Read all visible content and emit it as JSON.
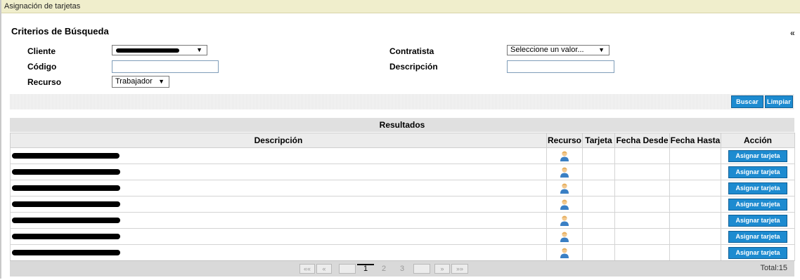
{
  "window_title": "Asignación de tarjetas",
  "criteria": {
    "title": "Criterios de Búsqueda",
    "collapse_glyph": "«",
    "cliente_label": "Cliente",
    "cliente_value": "",
    "contratista_label": "Contratista",
    "contratista_value": "Seleccione un valor...",
    "codigo_label": "Código",
    "codigo_value": "",
    "descripcion_label": "Descripción",
    "descripcion_value": "",
    "recurso_label": "Recurso",
    "recurso_value": "Trabajador"
  },
  "buttons": {
    "search": "Buscar",
    "clear": "Limpiar"
  },
  "results": {
    "title": "Resultados",
    "columns": [
      "Descripción",
      "Recurso",
      "Tarjeta",
      "Fecha Desde",
      "Fecha Hasta",
      "Acción"
    ],
    "action_label": "Asignar tarjeta",
    "row_count": 7
  },
  "pager": {
    "first": "««",
    "prev": "«",
    "pages": [
      "1",
      "2",
      "3"
    ],
    "current_page": "1",
    "next": "»",
    "last": "»»",
    "total_text": "Total:15"
  },
  "colors": {
    "accent": "#1d8bd0",
    "title_bar": "#f0eecc",
    "header_bg": "#e0e0e0"
  },
  "icons": {
    "recurso": "person-icon",
    "arrow": "dropdown-arrow-icon"
  }
}
